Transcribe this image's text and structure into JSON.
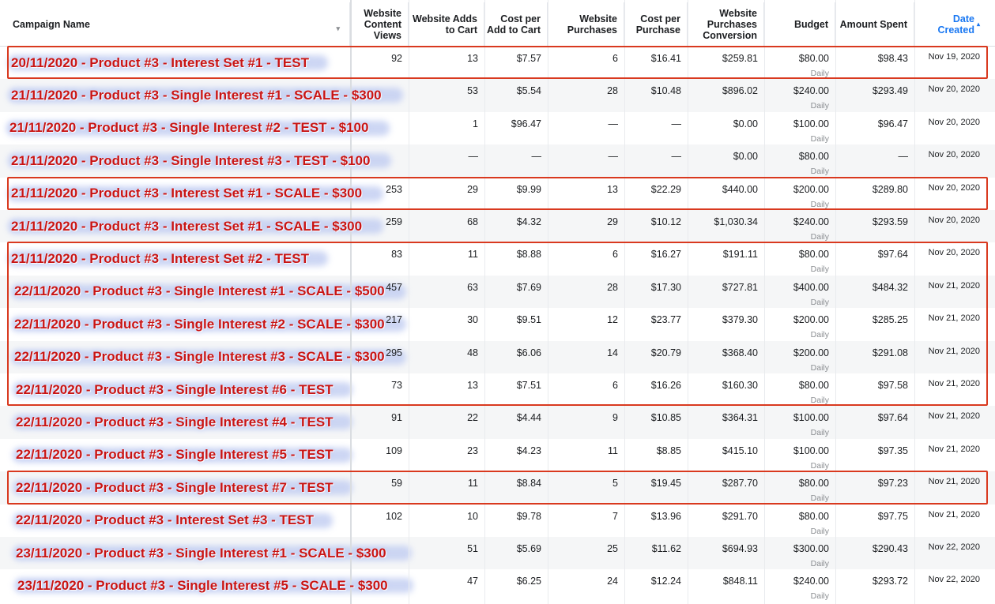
{
  "columns": [
    {
      "key": "name",
      "label": "Campaign Name"
    },
    {
      "key": "views",
      "label": "Website Content Views"
    },
    {
      "key": "adds",
      "label": "Website Adds to Cart"
    },
    {
      "key": "cpa",
      "label": "Cost per Add to Cart"
    },
    {
      "key": "purchases",
      "label": "Website Purchases"
    },
    {
      "key": "cpp",
      "label": "Cost per Purchase"
    },
    {
      "key": "conv",
      "label": "Website Purchases Conversion"
    },
    {
      "key": "budget",
      "label": "Budget"
    },
    {
      "key": "spent",
      "label": "Amount Spent"
    },
    {
      "key": "date",
      "label": "Date Created"
    }
  ],
  "sort_indicator": "▾",
  "sort_active_indicator": "▴",
  "budget_sub": "Daily",
  "rows": [
    {
      "name": "20/11/2020 - Product #3 - Interest Set #1 - TEST",
      "views": "92",
      "adds": "13",
      "cpa": "$7.57",
      "purchases": "6",
      "cpp": "$16.41",
      "conv": "$259.81",
      "budget": "$80.00",
      "spent": "$98.43",
      "date": "Nov 19, 2020"
    },
    {
      "name": "21/11/2020 - Product #3 - Single Interest #1 - SCALE - $300",
      "views": "",
      "adds": "53",
      "cpa": "$5.54",
      "purchases": "28",
      "cpp": "$10.48",
      "conv": "$896.02",
      "budget": "$240.00",
      "spent": "$293.49",
      "date": "Nov 20, 2020"
    },
    {
      "name": "21/11/2020 - Product #3 - Single Interest #2 - TEST - $100",
      "views": "",
      "adds": "1",
      "cpa": "$96.47",
      "purchases": "—",
      "cpp": "—",
      "conv": "$0.00",
      "budget": "$100.00",
      "spent": "$96.47",
      "date": "Nov 20, 2020"
    },
    {
      "name": "21/11/2020 - Product #3 - Single Interest #3 - TEST - $100",
      "views": "",
      "adds": "—",
      "cpa": "—",
      "purchases": "—",
      "cpp": "—",
      "conv": "$0.00",
      "budget": "$80.00",
      "spent": "—",
      "date": "Nov 20, 2020"
    },
    {
      "name": "21/11/2020 - Product #3 - Interest Set #1 - SCALE - $300",
      "views": "253",
      "adds": "29",
      "cpa": "$9.99",
      "purchases": "13",
      "cpp": "$22.29",
      "conv": "$440.00",
      "budget": "$200.00",
      "spent": "$289.80",
      "date": "Nov 20, 2020"
    },
    {
      "name": "21/11/2020 - Product #3 - Interest Set #1 - SCALE - $300",
      "views": "259",
      "adds": "68",
      "cpa": "$4.32",
      "purchases": "29",
      "cpp": "$10.12",
      "conv": "$1,030.34",
      "budget": "$240.00",
      "spent": "$293.59",
      "date": "Nov 20, 2020"
    },
    {
      "name": "21/11/2020 - Product #3 - Interest Set #2 - TEST",
      "views": "83",
      "adds": "11",
      "cpa": "$8.88",
      "purchases": "6",
      "cpp": "$16.27",
      "conv": "$191.11",
      "budget": "$80.00",
      "spent": "$97.64",
      "date": "Nov 20, 2020"
    },
    {
      "name": "22/11/2020 - Product #3 - Single Interest #1 - SCALE - $500",
      "views": "457",
      "adds": "63",
      "cpa": "$7.69",
      "purchases": "28",
      "cpp": "$17.30",
      "conv": "$727.81",
      "budget": "$400.00",
      "spent": "$484.32",
      "date": "Nov 21, 2020"
    },
    {
      "name": "22/11/2020 - Product #3 - Single Interest #2 - SCALE - $300",
      "views": "217",
      "adds": "30",
      "cpa": "$9.51",
      "purchases": "12",
      "cpp": "$23.77",
      "conv": "$379.30",
      "budget": "$200.00",
      "spent": "$285.25",
      "date": "Nov 21, 2020"
    },
    {
      "name": "22/11/2020 - Product #3 - Single Interest #3 - SCALE - $300",
      "views": "295",
      "adds": "48",
      "cpa": "$6.06",
      "purchases": "14",
      "cpp": "$20.79",
      "conv": "$368.40",
      "budget": "$200.00",
      "spent": "$291.08",
      "date": "Nov 21, 2020"
    },
    {
      "name": "22/11/2020 - Product #3 - Single Interest #6 - TEST",
      "views": "73",
      "adds": "13",
      "cpa": "$7.51",
      "purchases": "6",
      "cpp": "$16.26",
      "conv": "$160.30",
      "budget": "$80.00",
      "spent": "$97.58",
      "date": "Nov 21, 2020"
    },
    {
      "name": "22/11/2020 - Product #3 - Single Interest #4 - TEST",
      "views": "91",
      "adds": "22",
      "cpa": "$4.44",
      "purchases": "9",
      "cpp": "$10.85",
      "conv": "$364.31",
      "budget": "$100.00",
      "spent": "$97.64",
      "date": "Nov 21, 2020"
    },
    {
      "name": "22/11/2020 - Product #3 - Single Interest #5 - TEST",
      "views": "109",
      "adds": "23",
      "cpa": "$4.23",
      "purchases": "11",
      "cpp": "$8.85",
      "conv": "$415.10",
      "budget": "$100.00",
      "spent": "$97.35",
      "date": "Nov 21, 2020"
    },
    {
      "name": "22/11/2020 - Product #3 - Single Interest #7 - TEST",
      "views": "59",
      "adds": "11",
      "cpa": "$8.84",
      "purchases": "5",
      "cpp": "$19.45",
      "conv": "$287.70",
      "budget": "$80.00",
      "spent": "$97.23",
      "date": "Nov 21, 2020"
    },
    {
      "name": "22/11/2020 - Product #3 - Interest Set #3 - TEST",
      "views": "102",
      "adds": "10",
      "cpa": "$9.78",
      "purchases": "7",
      "cpp": "$13.96",
      "conv": "$291.70",
      "budget": "$80.00",
      "spent": "$97.75",
      "date": "Nov 21, 2020"
    },
    {
      "name": "23/11/2020 - Product #3 - Single Interest #1 - SCALE - $300",
      "views": "",
      "adds": "51",
      "cpa": "$5.69",
      "purchases": "25",
      "cpp": "$11.62",
      "conv": "$694.93",
      "budget": "$300.00",
      "spent": "$290.43",
      "date": "Nov 22, 2020"
    },
    {
      "name": "23/11/2020 - Product #3 - Single Interest #5 - SCALE - $300",
      "views": "",
      "adds": "47",
      "cpa": "$6.25",
      "purchases": "24",
      "cpp": "$12.24",
      "conv": "$848.11",
      "budget": "$240.00",
      "spent": "$293.72",
      "date": "Nov 22, 2020"
    }
  ],
  "highlight_color": "#d9391f",
  "name_color": "#c81414"
}
